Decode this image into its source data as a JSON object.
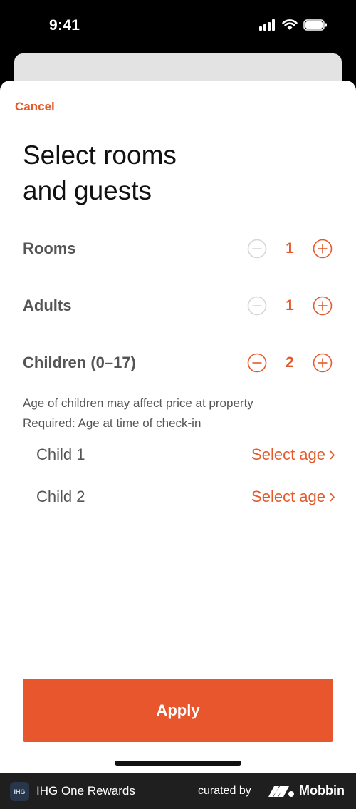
{
  "status_bar": {
    "time": "9:41"
  },
  "sheet": {
    "cancel_label": "Cancel",
    "title_line1": "Select rooms",
    "title_line2": "and guests",
    "counters": [
      {
        "label": "Rooms",
        "value": "1",
        "minus_enabled": false
      },
      {
        "label": "Adults",
        "value": "1",
        "minus_enabled": false
      },
      {
        "label": "Children (0–17)",
        "value": "2",
        "minus_enabled": true
      }
    ],
    "note_line1": "Age of children may affect price at property",
    "note_line2": "Required: Age at time of check-in",
    "children": [
      {
        "label": "Child 1",
        "action": "Select age"
      },
      {
        "label": "Child 2",
        "action": "Select age"
      }
    ],
    "apply_label": "Apply"
  },
  "footer": {
    "app_logo_text": "IHG",
    "app_name": "IHG One Rewards",
    "curated_by": "curated by",
    "brand": "Mobbin"
  },
  "colors": {
    "accent": "#e8562d",
    "accent_text": "#e35a2d",
    "disabled": "#d6d6d6",
    "label": "#555555"
  },
  "icons": [
    "signal-icon",
    "wifi-icon",
    "battery-icon",
    "minus-circle-icon",
    "plus-circle-icon",
    "chevron-right-icon",
    "mobbin-logo-icon"
  ]
}
